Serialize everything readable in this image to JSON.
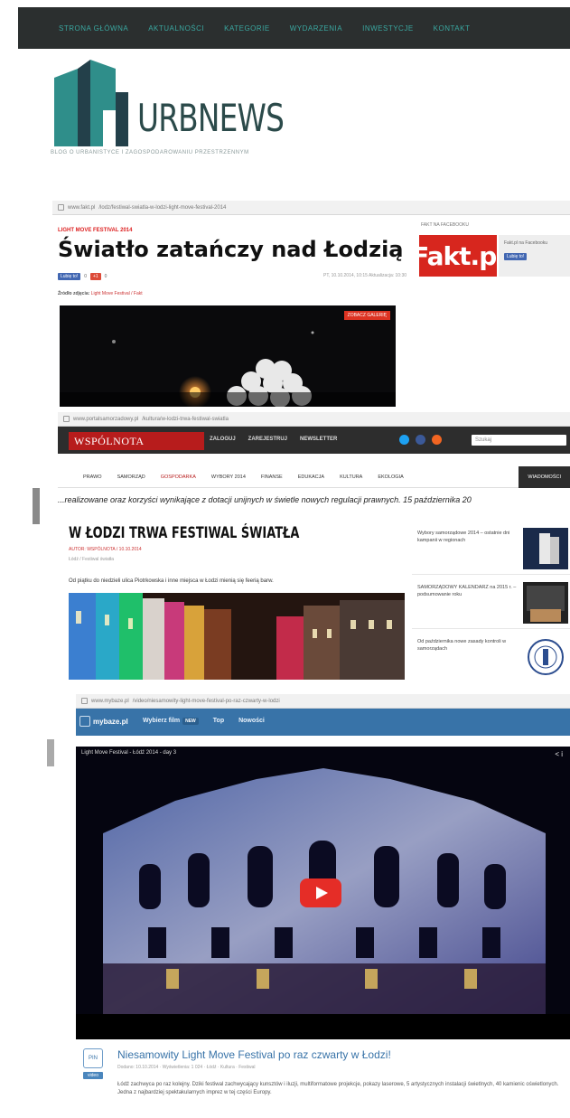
{
  "nav": {
    "items": [
      "Strona główna",
      "Aktualności",
      "Kategorie",
      "Wydarzenia",
      "Inwestycje",
      "Kontakt"
    ]
  },
  "logo": {
    "wordmark": "URBNEWS",
    "tagline": "BLOG O URBANISTYCE I ZAGOSPODAROWANIU PRZESTRZENNYM",
    "colors": {
      "teal": "#2f8e8a",
      "dark": "#23404a"
    }
  },
  "fakt": {
    "url_domain": "www.fakt.pl",
    "url_path": "/lodz/festiwal-swiatla-w-lodzi-light-move-festival-2014",
    "kicker": "LIGHT MOVE FESTIVAL 2014",
    "headline": "Światło zatańczy nad Łodzią",
    "like_label": "Lubię to!",
    "like_count": "0",
    "gplus_label": "+1",
    "gplus_count": "0",
    "date": "PT, 10.10.2014, 10:15 Aktualizacja: 10:30",
    "source_label": "Źródło zdjęcia:",
    "source_value": "Light Move Festival / Fakt",
    "photo_badge": "ZOBACZ GALERIĘ",
    "side_label": "FAKT NA FACEBOOKU",
    "logo_text": "Fakt.pl",
    "side_likes_text": "Fakt.pl na Facebooku",
    "side_like_button": "Lubię to!"
  },
  "wspolnota": {
    "url_domain": "www.portalsamorzadowy.pl",
    "url_path": "/kultura/w-lodzi-trwa-festiwal-swiatla",
    "logo_text": "WSPÓLNOTA",
    "top_nav": [
      "Zaloguj",
      "Zarejestruj",
      "Newsletter"
    ],
    "search_placeholder": "Szukaj",
    "sub_nav": [
      "Prawo",
      "Samorząd",
      "Gospodarka",
      "Wybory 2014",
      "Finanse",
      "Edukacja",
      "Kultura",
      "Ekologia"
    ],
    "sub_nav_last": "Wiadomości",
    "ticker": "...realizowane oraz korzyści wynikające z dotacji unijnych w świetle nowych regulacji prawnych.   15 października 20",
    "article_title": "W ŁODZI TRWA FESTIWAL ŚWIATŁA",
    "meta": "AUTOR: WSPÓLNOTA / 10.10.2014",
    "meta2": "Łódź / Festiwal światła",
    "lead": "Od piątku do niedzieli ulica Piotrkowska i inne miejsca w Łodzi mienią się feerią barw.",
    "sidebar": [
      {
        "title": "Wybory samorządowe 2014 – ostatnie dni kampanii w regionach"
      },
      {
        "title": "SAMORZĄDOWY KALENDARZ na 2015 r. – podsumowanie roku"
      },
      {
        "title": "Od października nowe zasady kontroli w samorządach"
      }
    ]
  },
  "mybaze": {
    "url_domain": "www.mybaze.pl",
    "url_path": "/video/niesamowity-light-move-festival-po-raz-czwarty-w-lodzi",
    "brand": "mybaze.pl",
    "nav": {
      "section": "Wybierz film",
      "pill": "NEW",
      "links": [
        "Top",
        "Nowości"
      ]
    },
    "player_title": "Light Move Festival - Łódź 2014 - day 3",
    "player_icons": "< i",
    "video_title": "Niesamowity Light Move Festival po raz czwarty w Łodzi!",
    "video_meta": "Dodano: 10.10.2014 · Wyświetlenia: 1 024 · Łódź · Kultura · Festiwal",
    "video_desc": "Łódź zachwyca po raz kolejny. Dziki festiwal zachwycający kunsztów i iluzji, multiformatowe projekcje, pokazy laserowe, 5 artystycznych instalacji świetlnych, 40 kamienic oświetlonych. Jedna z najbardziej spektakularnych imprez w tej części Europy.",
    "badge_top": "PIN",
    "badge_bottom": "video",
    "play_color": "#e52d27"
  }
}
